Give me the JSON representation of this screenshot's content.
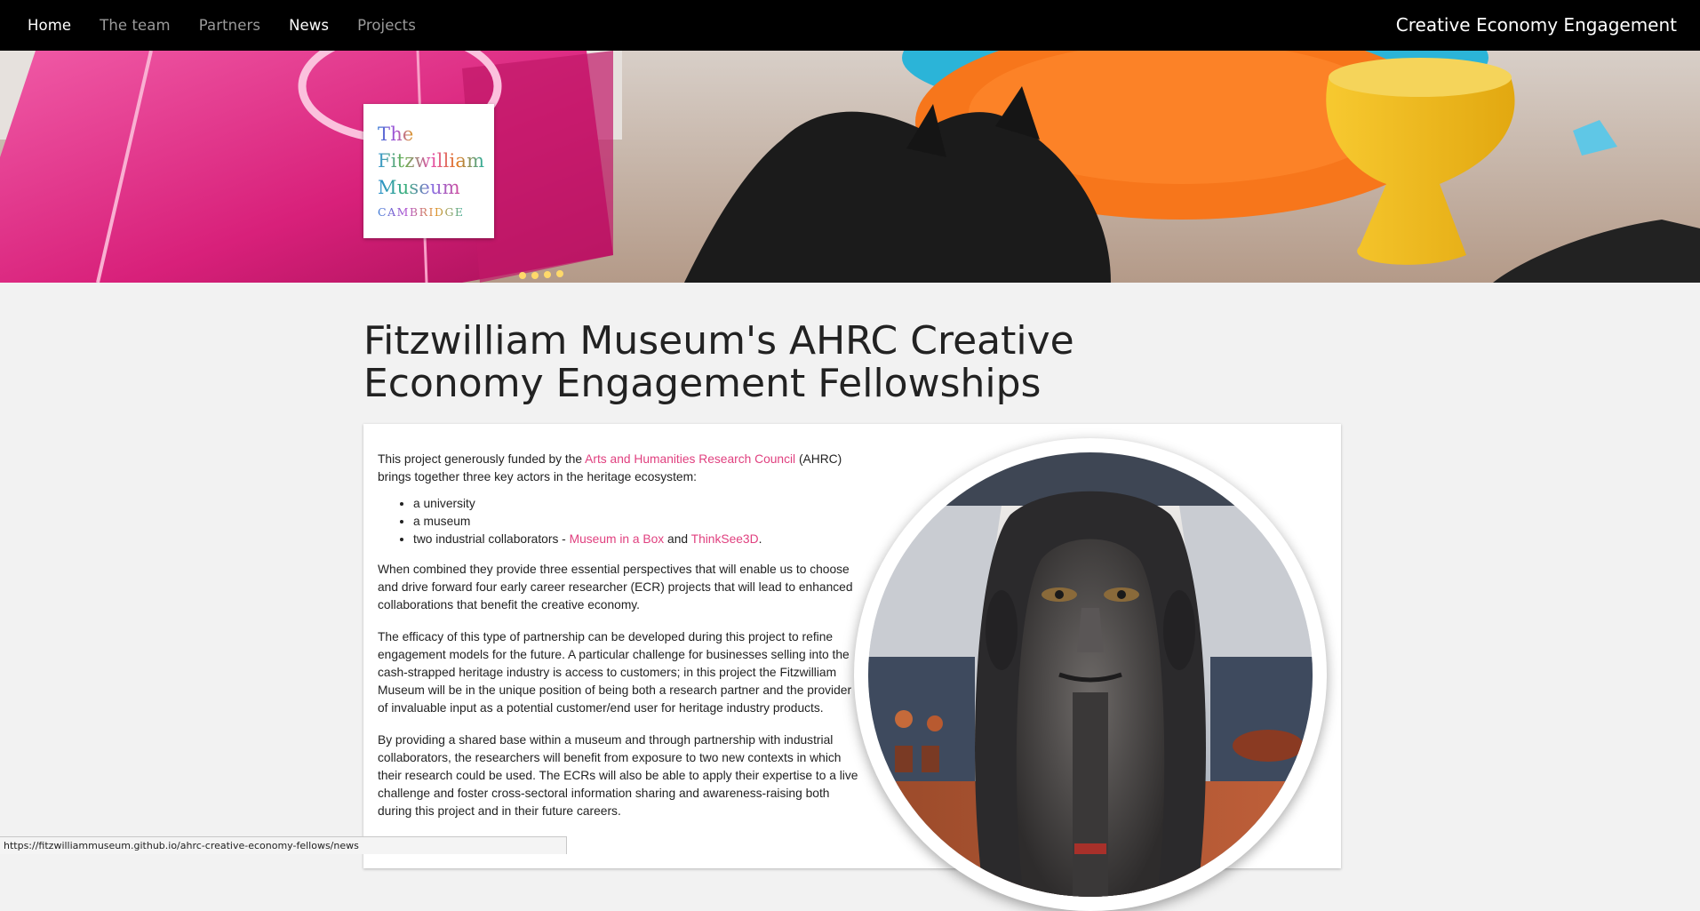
{
  "nav": {
    "links": [
      {
        "label": "Home"
      },
      {
        "label": "The team"
      },
      {
        "label": "Partners"
      },
      {
        "label": "News"
      },
      {
        "label": "Projects"
      }
    ],
    "brand": "Creative Economy Engagement"
  },
  "logo": {
    "line1": "The",
    "line2": "Fitzwilliam",
    "line3": "Museum",
    "line4": "CAMBRIDGE"
  },
  "page": {
    "title": "Fitzwilliam Museum's AHRC Creative Economy Engagement Fellowships"
  },
  "content": {
    "intro_before": "This project generously funded by the ",
    "intro_link": "Arts and Humanities Research Council",
    "intro_after": " (AHRC) brings together three key actors in the heritage ecosystem:",
    "list": {
      "item1": "a university",
      "item2": "a museum",
      "item3_before": "two industrial collaborators - ",
      "item3_link1": "Museum in a Box",
      "item3_mid": " and ",
      "item3_link2": "ThinkSee3D",
      "item3_after": "."
    },
    "para2": "When combined they provide three essential perspectives that will enable us to choose and drive forward four early career researcher (ECR) projects that will lead to enhanced collaborations that benefit the creative economy.",
    "para3": "The efficacy of this type of partnership can be developed during this project to refine engagement models for the future. A particular challenge for businesses selling into the cash-strapped heritage industry is access to customers; in this project the Fitzwilliam Museum will be in the unique position of being both a research partner and the provider of invaluable input as a potential customer/end user for heritage industry products.",
    "para4": "By providing a shared base within a museum and through partnership with industrial collaborators, the researchers will benefit from exposure to two new contexts in which their research could be used. The ECRs will also be able to apply their expertise to a live challenge and foster cross-sectoral information sharing and awareness-raising both during this project and in their future careers."
  },
  "status_bar": {
    "url": "https://fitzwilliammuseum.github.io/ahrc-creative-economy-fellows/news"
  },
  "colors": {
    "nav_bg": "#000000",
    "link_accent": "#e0407f",
    "page_bg": "#f2f2f2"
  }
}
